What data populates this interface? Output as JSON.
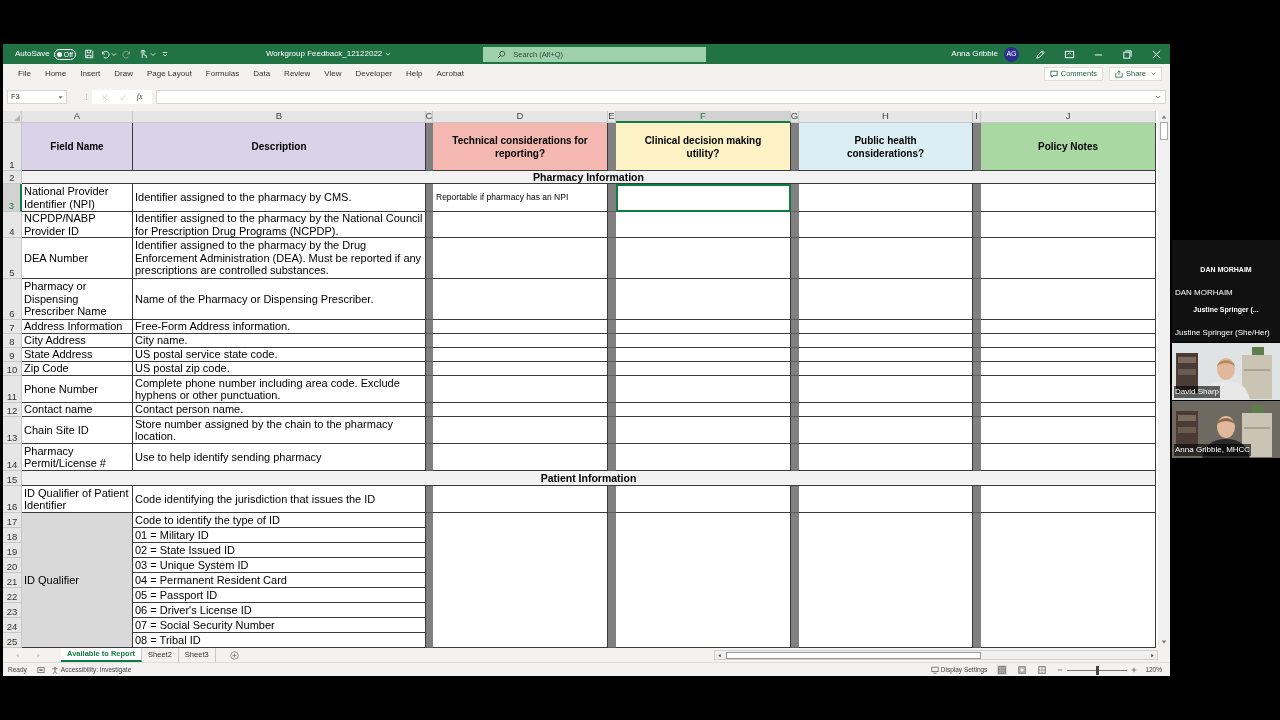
{
  "title_bar": {
    "autosave_label": "AutoSave",
    "autosave_state": "Off",
    "autosave_on": false,
    "file_title": "Workgroup Feedback_12122022",
    "search_placeholder": "Search (Alt+Q)",
    "user_name": "Anna Gribble",
    "user_initials": "AG"
  },
  "menu": [
    "File",
    "Home",
    "Insert",
    "Draw",
    "Page Layout",
    "Formulas",
    "Data",
    "Review",
    "View",
    "Developer",
    "Help",
    "Acrobat"
  ],
  "comments_label": "Comments",
  "share_label": "Share",
  "formula_bar": {
    "name_box": "F3",
    "function_label": "fx"
  },
  "columns": [
    {
      "letter": "A",
      "selected": false
    },
    {
      "letter": "B",
      "selected": false
    },
    {
      "letter": "C",
      "selected": false
    },
    {
      "letter": "D",
      "selected": false
    },
    {
      "letter": "E",
      "selected": false
    },
    {
      "letter": "F",
      "selected": true
    },
    {
      "letter": "G",
      "selected": false
    },
    {
      "letter": "H",
      "selected": false
    },
    {
      "letter": "I",
      "selected": false
    },
    {
      "letter": "J",
      "selected": false
    }
  ],
  "header_row": {
    "number": "1",
    "selected": false,
    "cells": [
      {
        "text": "Field Name",
        "color": "#d9d2e9"
      },
      {
        "text": "Description",
        "color": "#d9d2e9"
      },
      {
        "text": "Technical considerations for reporting?",
        "color": "#f4b8b0"
      },
      {
        "text": "Clinical decision making utility?",
        "color": "#fdf1c6"
      },
      {
        "text": "Public health considerations?",
        "color": "#dbeef3"
      },
      {
        "text": "Policy Notes",
        "color": "#a9d8a3"
      }
    ]
  },
  "rows": [
    {
      "kind": "section",
      "number": "2",
      "selected": false,
      "title": "Pharmacy Information"
    },
    {
      "kind": "data",
      "number": "3",
      "selected": true,
      "field_name": "National Provider Identifier (NPI)",
      "description": "Identifier assigned to the pharmacy by CMS.",
      "technical_note": "Reportable if pharmacy has an NPI"
    },
    {
      "kind": "data",
      "number": "4",
      "selected": false,
      "field_name": "NCPDP/NABP Provider ID",
      "description": "Identifier assigned to the pharmacy by the National Council for Prescription Drug Programs (NCPDP)."
    },
    {
      "kind": "data",
      "number": "5",
      "selected": false,
      "field_name": "DEA Number",
      "description": "Identifier assigned to the pharmacy by the Drug Enforcement Administration (DEA). Must be reported if any prescriptions are controlled substances."
    },
    {
      "kind": "data",
      "number": "6",
      "selected": false,
      "field_name": "Pharmacy or Dispensing Prescriber Name",
      "description": "Name of the Pharmacy or Dispensing Prescriber."
    },
    {
      "kind": "data",
      "number": "7",
      "selected": false,
      "field_name": "Address Information",
      "description": "Free-Form Address information."
    },
    {
      "kind": "data",
      "number": "8",
      "selected": false,
      "field_name": "City Address",
      "description": "City name."
    },
    {
      "kind": "data",
      "number": "9",
      "selected": false,
      "field_name": "State Address",
      "description": "US postal service state code."
    },
    {
      "kind": "data",
      "number": "10",
      "selected": false,
      "field_name": "Zip Code",
      "description": "US postal zip code."
    },
    {
      "kind": "data",
      "number": "11",
      "selected": false,
      "field_name": "Phone Number",
      "description": "Complete phone number including area code. Exclude hyphens or other punctuation."
    },
    {
      "kind": "data",
      "number": "12",
      "selected": false,
      "field_name": "Contact name",
      "description": "Contact person name."
    },
    {
      "kind": "data",
      "number": "13",
      "selected": false,
      "field_name": "Chain Site ID",
      "description": "Store number assigned by the chain to the pharmacy location."
    },
    {
      "kind": "data",
      "number": "14",
      "selected": false,
      "field_name": "Pharmacy Permit/License #",
      "description": "Use to help identify sending pharmacy"
    },
    {
      "kind": "section",
      "number": "15",
      "selected": false,
      "title": "Patient Information"
    },
    {
      "kind": "data",
      "number": "16",
      "selected": false,
      "field_name": "ID Qualifier of Patient Identifier",
      "description": "Code identifying the jurisdiction that issues the ID"
    },
    {
      "kind": "group",
      "field_name": "ID Qualifier",
      "entries": [
        {
          "number": "17",
          "selected": false,
          "description": "Code to identify the type of ID"
        },
        {
          "number": "18",
          "selected": false,
          "description": "01 = Military ID"
        },
        {
          "number": "19",
          "selected": false,
          "description": "02 = State Issued ID"
        },
        {
          "number": "20",
          "selected": false,
          "description": "03 = Unique System ID"
        },
        {
          "number": "21",
          "selected": false,
          "description": "04 = Permanent Resident Card"
        },
        {
          "number": "22",
          "selected": false,
          "description": "05 = Passport ID"
        },
        {
          "number": "23",
          "selected": false,
          "description": "06 = Driver's License ID"
        },
        {
          "number": "24",
          "selected": false,
          "description": "07 = Social Security Number"
        },
        {
          "number": "25",
          "selected": false,
          "description": "08 = Tribal ID"
        }
      ]
    }
  ],
  "sheet_tabs": [
    {
      "label": "Available to Report",
      "selected": true
    },
    {
      "label": "Sheet2",
      "selected": false
    },
    {
      "label": "Sheet3",
      "selected": false
    }
  ],
  "status_bar": {
    "ready": "Ready",
    "accessibility": "Accessibility: Investigate",
    "display_settings": "Display Settings",
    "views": [
      {
        "kind": "normal",
        "selected": true
      },
      {
        "kind": "page_layout",
        "selected": false
      },
      {
        "kind": "page_break",
        "selected": false
      }
    ],
    "zoom_slider": {
      "level": 0.5
    },
    "zoom": "120%"
  },
  "participants": [
    {
      "kind": "name_tile",
      "label": "DAN MORHAIM",
      "name": "DAN MORHAIM"
    },
    {
      "kind": "name_tile",
      "label": "Justine Springer (...",
      "name": "Justine Springer (She/Her)"
    },
    {
      "kind": "video",
      "name": "David Sharp"
    },
    {
      "kind": "video",
      "name": "Anna Gribble, MHCC"
    }
  ]
}
